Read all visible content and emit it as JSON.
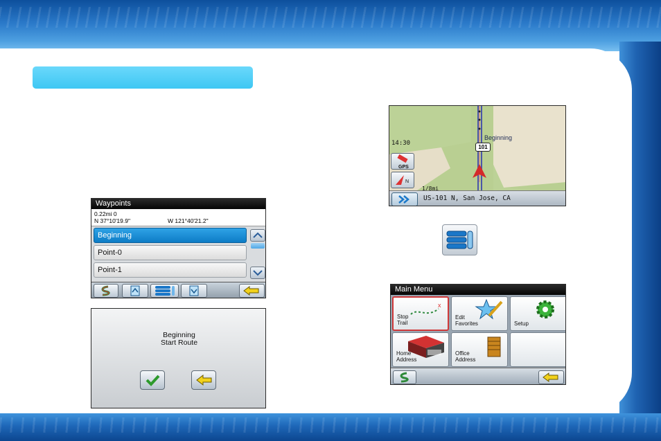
{
  "waypoints_screen": {
    "title": "Waypoints",
    "distance": "0.22mi  0",
    "lat": "N 37°10'19.9\"",
    "lon": "W 121°40'21.2\"",
    "items": [
      {
        "label": "Beginning",
        "selected": true
      },
      {
        "label": "Point-0",
        "selected": false
      },
      {
        "label": "Point-1",
        "selected": false
      }
    ],
    "toolbar": {
      "route_icon": "route-icon",
      "back_icon": "back-arrow-icon"
    }
  },
  "confirm_dialog": {
    "line1": "Beginning",
    "line2": "Start Route",
    "ok_icon": "checkmark-icon",
    "back_icon": "back-arrow-icon"
  },
  "map_screen": {
    "time": "14:30",
    "location_label": "Beginning",
    "route_shield": "101",
    "gps_label": "GPS",
    "compass_label": "N",
    "scale": "1/8mi",
    "address": "US-101 N, San Jose, CA"
  },
  "main_menu": {
    "title": "Main Menu",
    "tiles": [
      {
        "label1": "Stop",
        "label2": "Trail"
      },
      {
        "label1": "Edit",
        "label2": "Favorites"
      },
      {
        "label1": "",
        "label2": "Setup"
      },
      {
        "label1": "Home",
        "label2": "Address"
      },
      {
        "label1": "Office",
        "label2": "Address"
      }
    ]
  },
  "colors": {
    "accent_blue": "#3ec7f3",
    "selected_item": "#0d7cc6",
    "stop_trail_border": "#d0393a"
  }
}
